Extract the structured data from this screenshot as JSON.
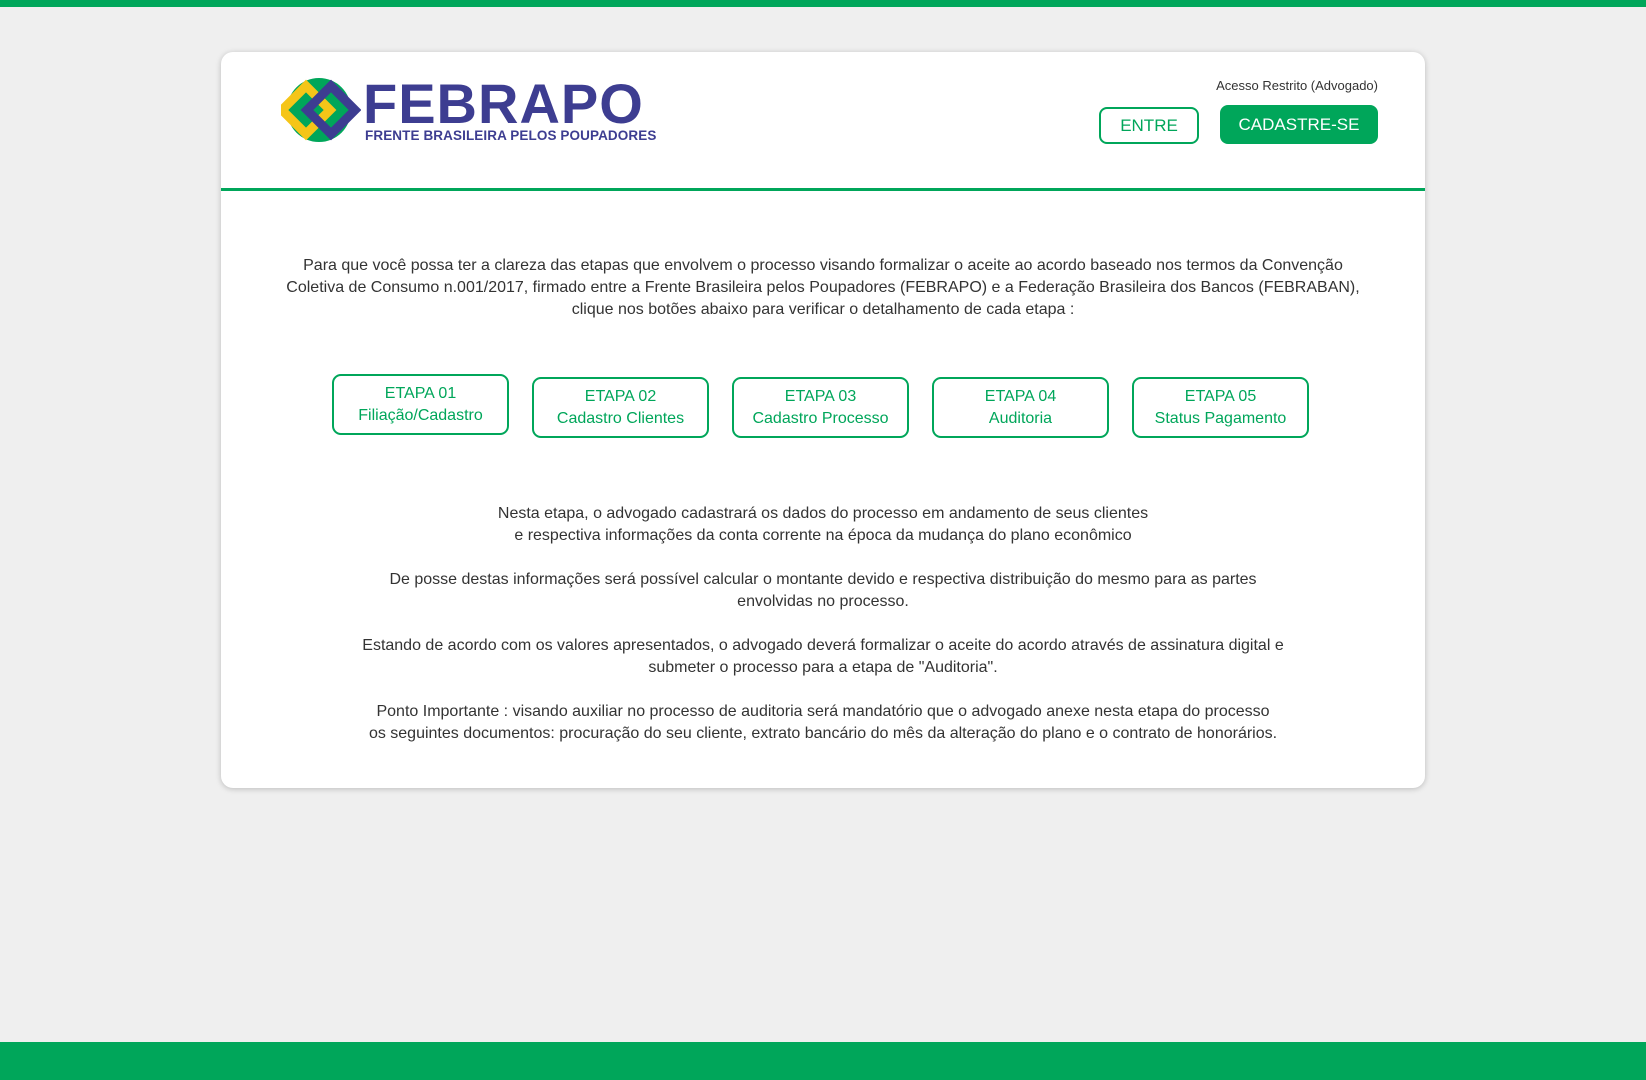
{
  "colors": {
    "accent": "#00a65a",
    "brand_navy": "#3d3d91",
    "brand_yellow": "#f5c518",
    "background": "#efefef",
    "text": "#333333"
  },
  "logo": {
    "name": "FEBRAPO",
    "tagline": "FRENTE BRASILEIRA PELOS POUPADORES",
    "icon": "interlocked-squares-logo-icon"
  },
  "header": {
    "restricted_label": "Acesso Restrito (Advogado)",
    "login_label": "ENTRE",
    "signup_label": "CADASTRE-SE"
  },
  "intro": {
    "lines": [
      "Para que você possa ter a clareza das etapas que envolvem o processo visando formalizar o aceite ao acordo baseado nos termos da Convenção",
      "Coletiva de Consumo n.001/2017, firmado entre a Frente Brasileira pelos Poupadores (FEBRAPO) e a Federação Brasileira dos Bancos (FEBRABAN),",
      "clique nos botões abaixo para verificar o detalhamento de cada etapa :"
    ]
  },
  "steps": [
    {
      "label": "ETAPA 01",
      "title": "Filiação/Cadastro"
    },
    {
      "label": "ETAPA 02",
      "title": "Cadastro Clientes"
    },
    {
      "label": "ETAPA 03",
      "title": "Cadastro Processo"
    },
    {
      "label": "ETAPA 04",
      "title": "Auditoria"
    },
    {
      "label": "ETAPA 05",
      "title": "Status Pagamento"
    }
  ],
  "details": {
    "paragraphs": [
      [
        "Nesta etapa, o advogado cadastrará os dados do processo em andamento de seus clientes",
        "e respectiva informações da conta corrente na época da mudança do plano econômico"
      ],
      [
        "De posse destas informações será possível calcular o montante devido e respectiva distribuição do mesmo para as partes",
        "envolvidas no processo."
      ],
      [
        "Estando de acordo com os valores apresentados, o advogado deverá formalizar o aceite do acordo através de assinatura digital e",
        "submeter o processo para a etapa de \"Auditoria\"."
      ],
      [
        "Ponto Importante : visando auxiliar no processo de auditoria será mandatório que o advogado anexe nesta etapa do processo",
        "os seguintes documentos: procuração do seu cliente, extrato bancário do mês da alteração do plano e o contrato de honorários."
      ]
    ]
  }
}
